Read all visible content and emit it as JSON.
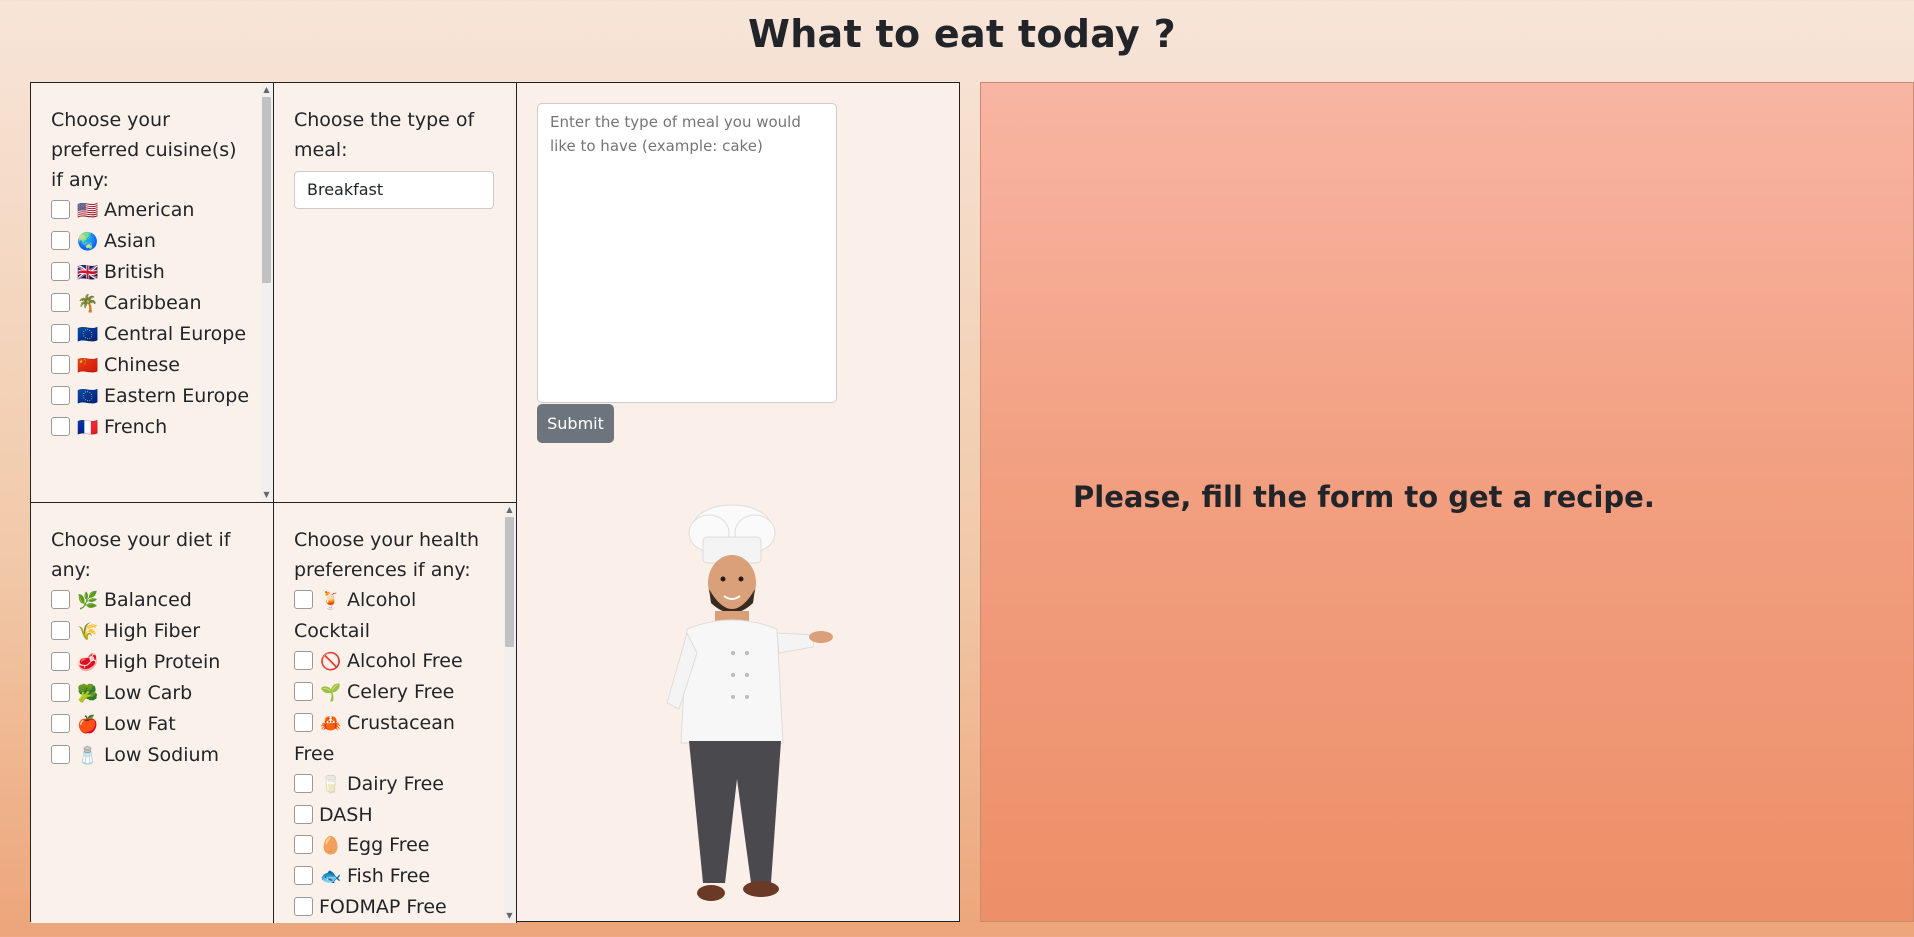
{
  "page": {
    "title": "What to eat today ?"
  },
  "cuisine": {
    "heading": "Choose your preferred cuisine(s) if any:",
    "items": [
      {
        "emoji": "🇺🇸",
        "label": "American"
      },
      {
        "emoji": "🌏",
        "label": "Asian"
      },
      {
        "emoji": "🇬🇧",
        "label": "British"
      },
      {
        "emoji": "🌴",
        "label": "Caribbean"
      },
      {
        "emoji": "🇪🇺",
        "label": "Central Europe"
      },
      {
        "emoji": "🇨🇳",
        "label": "Chinese"
      },
      {
        "emoji": "🇪🇺",
        "label": "Eastern Europe"
      },
      {
        "emoji": "🇫🇷",
        "label": "French"
      }
    ]
  },
  "meal_type": {
    "heading": "Choose the type of meal:",
    "selected": "Breakfast"
  },
  "diet": {
    "heading": "Choose your diet if any:",
    "items": [
      {
        "emoji": "🌿",
        "label": "Balanced"
      },
      {
        "emoji": "🌾",
        "label": "High Fiber"
      },
      {
        "emoji": "🥩",
        "label": "High Protein"
      },
      {
        "emoji": "🥦",
        "label": "Low Carb"
      },
      {
        "emoji": "🍎",
        "label": "Low Fat"
      },
      {
        "emoji": "🧂",
        "label": "Low Sodium"
      }
    ]
  },
  "health": {
    "heading": "Choose your health preferences if any:",
    "items": [
      {
        "emoji": "🍹",
        "label": "Alcohol Cocktail"
      },
      {
        "emoji": "🚫",
        "label": "Alcohol Free"
      },
      {
        "emoji": "🌱",
        "label": "Celery Free"
      },
      {
        "emoji": "🦀",
        "label": "Crustacean Free"
      },
      {
        "emoji": "🥛",
        "label": "Dairy Free"
      },
      {
        "emoji": "",
        "label": "DASH"
      },
      {
        "emoji": "🥚",
        "label": "Egg Free"
      },
      {
        "emoji": "🐟",
        "label": "Fish Free"
      },
      {
        "emoji": "",
        "label": "FODMAP Free"
      }
    ]
  },
  "request": {
    "placeholder": "Enter the type of meal you would like to have (example: cake)",
    "submit_label": "Submit"
  },
  "result": {
    "message": "Please, fill the form to get a recipe."
  },
  "colors": {
    "submit": "#6c757d",
    "result_top": "#f8b5a3",
    "result_bottom": "#ed8f68"
  }
}
